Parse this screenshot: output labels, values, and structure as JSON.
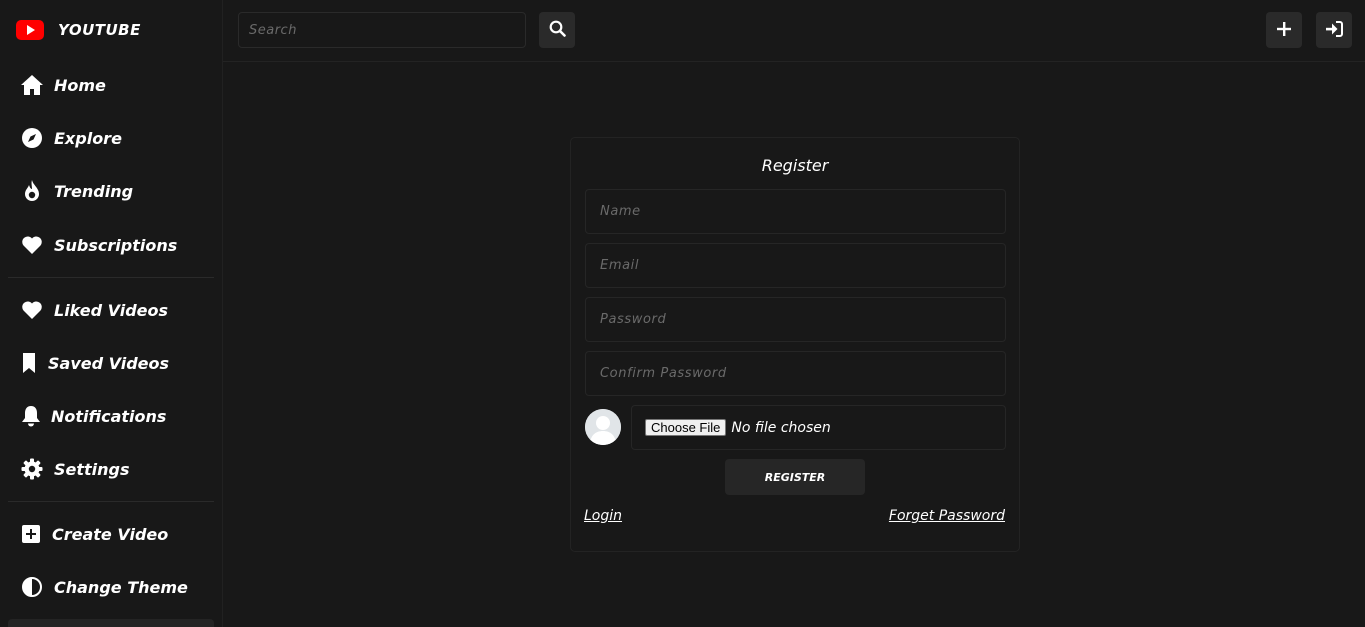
{
  "brand": {
    "name": "YOUTUBE",
    "logo_color": "#ff0000"
  },
  "sidebar": {
    "items": [
      {
        "label": "Home",
        "icon": "home-icon"
      },
      {
        "label": "Explore",
        "icon": "compass-icon"
      },
      {
        "label": "Trending",
        "icon": "fire-icon"
      },
      {
        "label": "Subscriptions",
        "icon": "heart-icon"
      },
      {
        "label": "Liked Videos",
        "icon": "heart-icon"
      },
      {
        "label": "Saved Videos",
        "icon": "bookmark-icon"
      },
      {
        "label": "Notifications",
        "icon": "bell-icon"
      },
      {
        "label": "Settings",
        "icon": "gear-icon"
      },
      {
        "label": "Create Video",
        "icon": "plus-square-icon"
      },
      {
        "label": "Change Theme",
        "icon": "half-circle-icon"
      }
    ]
  },
  "header": {
    "search_placeholder": "Search",
    "search_icon": "search-icon",
    "add_icon": "plus-icon",
    "login_icon": "sign-in-icon"
  },
  "register": {
    "title": "Register",
    "name_placeholder": "Name",
    "email_placeholder": "Email",
    "password_placeholder": "Password",
    "confirm_placeholder": "Confirm Password",
    "file_button": "Choose File",
    "file_status": "No file chosen",
    "submit_label": "REGISTER",
    "login_link": "Login",
    "forget_link": "Forget Password"
  }
}
